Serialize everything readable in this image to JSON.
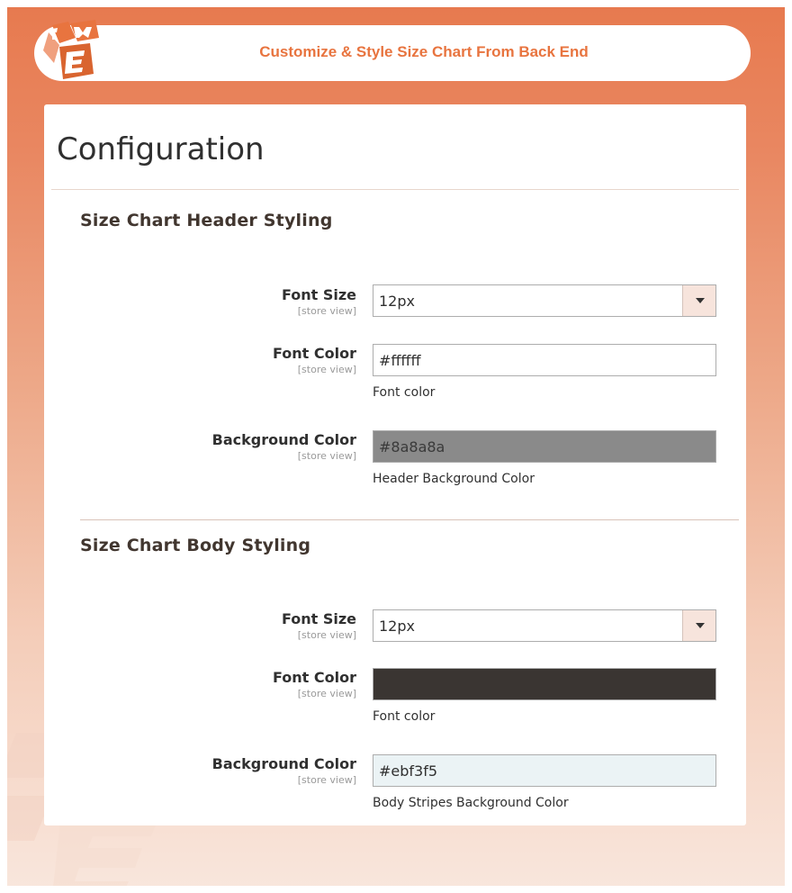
{
  "banner": {
    "title": "Customize & Style Size Chart From Back End"
  },
  "page": {
    "title": "Configuration"
  },
  "colors": {
    "accent": "#e8743f",
    "header_bg_swatch": "#8a8a8a",
    "body_font_swatch": "#3a3532",
    "body_bg_swatch": "#ebf3f5"
  },
  "header_section": {
    "title": "Size Chart Header Styling",
    "font_size": {
      "label": "Font Size",
      "scope": "[store view]",
      "value": "12px"
    },
    "font_color": {
      "label": "Font Color",
      "scope": "[store view]",
      "value": "#ffffff",
      "note": "Font color"
    },
    "background_color": {
      "label": "Background Color",
      "scope": "[store view]",
      "value": "#8a8a8a",
      "note": "Header Background Color"
    }
  },
  "body_section": {
    "title": "Size Chart Body Styling",
    "font_size": {
      "label": "Font Size",
      "scope": "[store view]",
      "value": "12px"
    },
    "font_color": {
      "label": "Font Color",
      "scope": "[store view]",
      "value": "",
      "note": "Font color"
    },
    "background_color": {
      "label": "Background Color",
      "scope": "[store view]",
      "value": "#ebf3f5",
      "note": "Body Stripes Background Color"
    }
  }
}
